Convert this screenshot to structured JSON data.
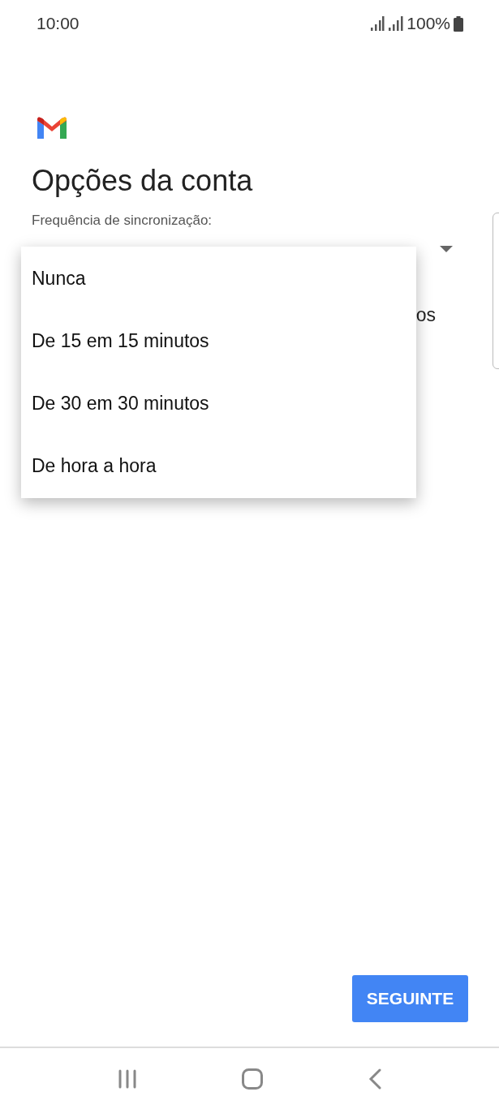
{
  "status_bar": {
    "time": "10:00",
    "battery": "100%"
  },
  "title": "Opções da conta",
  "sync_label": "Frequência de sincronização:",
  "behind_text": "os",
  "dropdown": {
    "expanded": true,
    "options": [
      {
        "label": "Nunca",
        "selected": false
      },
      {
        "label": "De 15 em 15 minutos",
        "selected": false
      },
      {
        "label": "De 30 em 30 minutos",
        "selected": false
      },
      {
        "label": "De hora a hora",
        "selected": false
      }
    ]
  },
  "next_button": "SEGUINTE"
}
